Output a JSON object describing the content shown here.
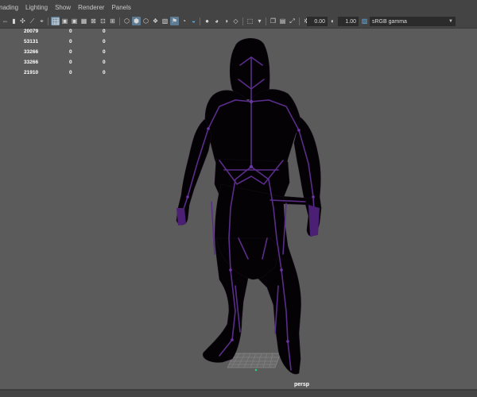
{
  "menu": [
    "nading",
    "Lighting",
    "Show",
    "Renderer",
    "Panels"
  ],
  "toolbar": {
    "exposure": "0.00",
    "gamma": "1.00",
    "color_space": "sRGB gamma"
  },
  "hud": {
    "rows": [
      [
        "20079",
        "0",
        "0"
      ],
      [
        "53131",
        "0",
        "0"
      ],
      [
        "33266",
        "0",
        "0"
      ],
      [
        "33266",
        "0",
        "0"
      ],
      [
        "21910",
        "0",
        "0"
      ]
    ]
  },
  "viewport": {
    "camera": "persp"
  },
  "colors": {
    "background": "#5b5b5b",
    "panel": "#444444",
    "active_button": "#5d7c94",
    "skeleton": "#5a2d8a",
    "hud_text": "#ffffff"
  }
}
